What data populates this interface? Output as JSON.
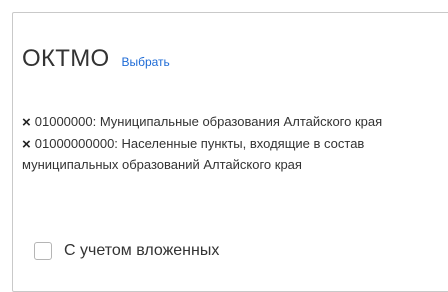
{
  "okato_filter": {
    "title": "ОКТМО",
    "select_link": "Выбрать",
    "chips": [
      {
        "remove_icon": "×",
        "text": "01000000: Муниципальные образования Алтайского края"
      },
      {
        "remove_icon": "×",
        "text": "01000000000: Населенные пункты, входящие в состав муниципальных образований Алтайского края"
      }
    ],
    "nested_checkbox_label": "С учетом вложенных",
    "nested_checked": false
  }
}
